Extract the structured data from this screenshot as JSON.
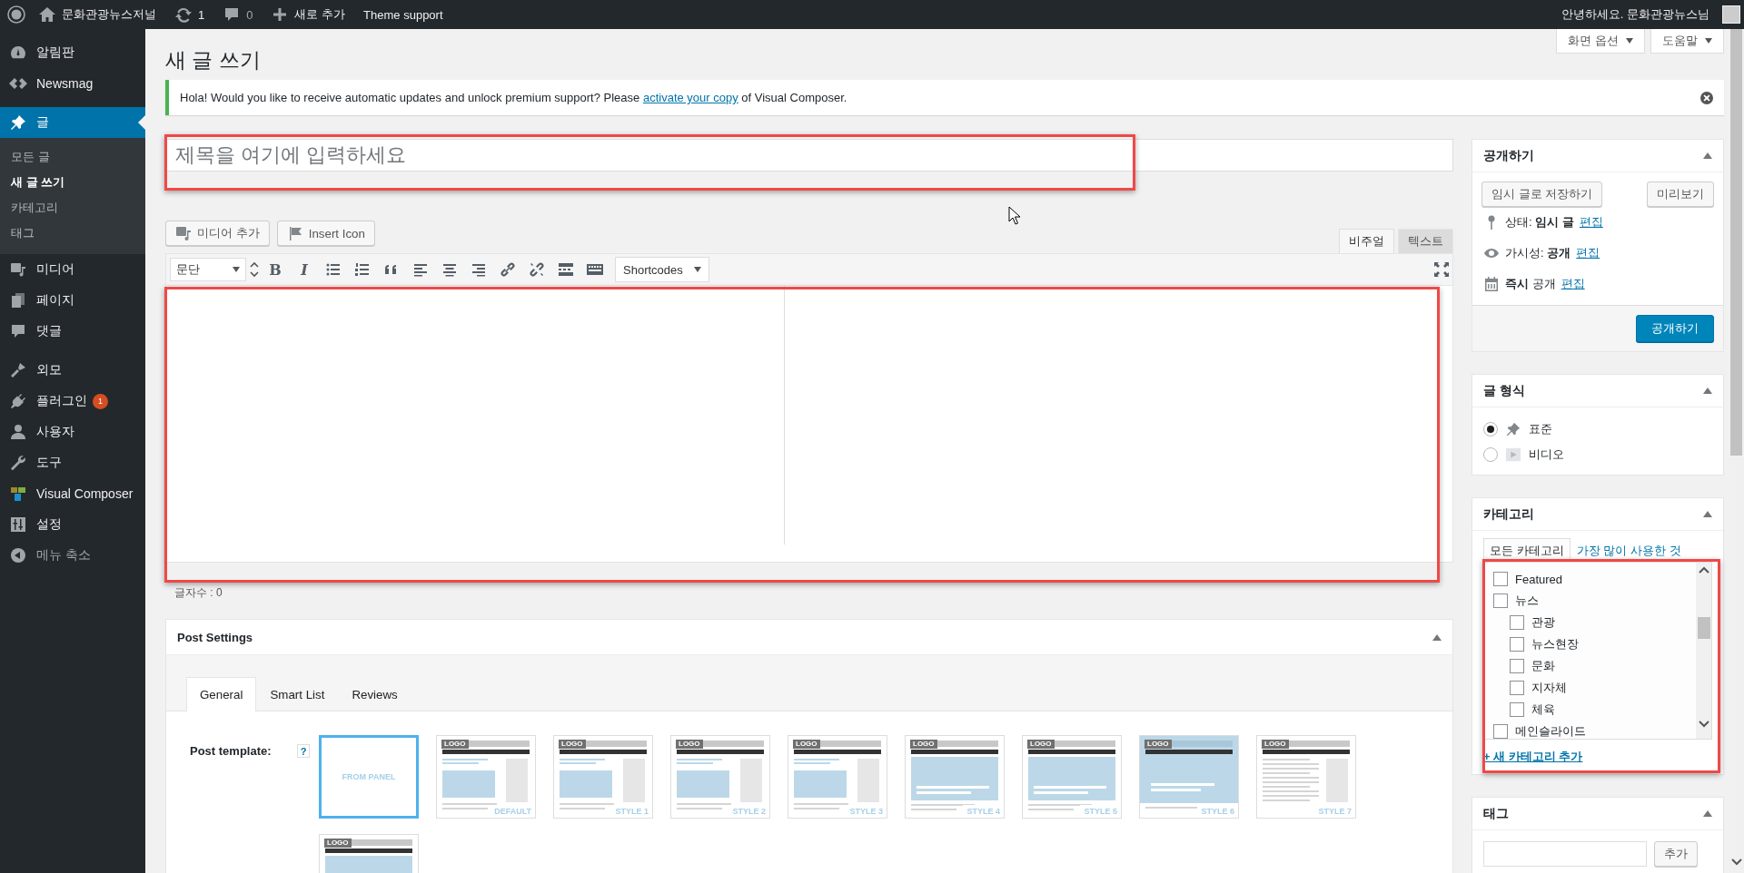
{
  "admin_bar": {
    "site_name": "문화관광뉴스저널",
    "updates": "1",
    "comments": "0",
    "new_label": "새로 추가",
    "theme_support": "Theme support",
    "greeting": "안녕하세요. 문화관광뉴스님"
  },
  "menu": [
    {
      "label": "알림판",
      "selected": false
    },
    {
      "label": "Newsmag",
      "selected": false
    },
    {
      "label": "글",
      "selected": true,
      "gap_before": true,
      "children": [
        {
          "label": "모든 글",
          "selected": false
        },
        {
          "label": "새 글 쓰기",
          "selected": true
        },
        {
          "label": "카테고리",
          "selected": false
        },
        {
          "label": "태그",
          "selected": false
        }
      ]
    },
    {
      "label": "미디어",
      "selected": false
    },
    {
      "label": "페이지",
      "selected": false
    },
    {
      "label": "댓글",
      "selected": false
    },
    {
      "label": "외모",
      "selected": false,
      "gap_before": true
    },
    {
      "label": "플러그인",
      "selected": false,
      "badge": "1"
    },
    {
      "label": "사용자",
      "selected": false
    },
    {
      "label": "도구",
      "selected": false
    },
    {
      "label": "Visual Composer",
      "selected": false
    },
    {
      "label": "설정",
      "selected": false
    },
    {
      "label": "메뉴 축소",
      "selected": false,
      "kind": "collapse"
    }
  ],
  "screen_links": [
    "화면 옵션",
    "도움말"
  ],
  "page_title": "새 글 쓰기",
  "notice": {
    "text": "Hola! Would you like to receive automatic updates and unlock premium support? Please ",
    "link": "activate your copy",
    "text_after": " of Visual Composer."
  },
  "title_field": {
    "placeholder": "제목을 여기에 입력하세요"
  },
  "editor": {
    "media_buttons": [
      "미디어 추가",
      "Insert Icon"
    ],
    "modes": [
      {
        "label": "비주얼",
        "selected": true
      },
      {
        "label": "텍스트",
        "selected": false
      }
    ],
    "format": "문단",
    "bold": "B",
    "italic": "I",
    "shortcodes": "Shortcodes",
    "word_count": "글자수 : 0"
  },
  "post_settings": {
    "title": "Post Settings",
    "tabs": [
      {
        "label": "General",
        "selected": true
      },
      {
        "label": "Smart List",
        "selected": false
      },
      {
        "label": "Reviews",
        "selected": false
      }
    ],
    "template_label": "Post template:",
    "help": "?",
    "templates": [
      {
        "label": "FROM PANEL",
        "kind": "panel",
        "selected": true
      },
      {
        "logo": "LOGO",
        "label": "DEFAULT",
        "kind": "sidebar",
        "selected": false
      },
      {
        "logo": "LOGO",
        "label": "STYLE 1",
        "kind": "sidebar",
        "selected": false
      },
      {
        "logo": "LOGO",
        "label": "STYLE 2",
        "kind": "sidebar",
        "selected": false
      },
      {
        "logo": "LOGO",
        "label": "STYLE 3",
        "kind": "sidebar",
        "selected": false
      },
      {
        "logo": "LOGO",
        "label": "STYLE 4",
        "kind": "full",
        "selected": false
      },
      {
        "logo": "LOGO",
        "label": "STYLE 5",
        "kind": "full",
        "selected": false
      },
      {
        "logo": "LOGO",
        "label": "STYLE 6",
        "kind": "overlay",
        "selected": false
      },
      {
        "logo": "LOGO",
        "label": "STYLE 7",
        "kind": "text",
        "selected": false
      },
      {
        "logo": "LOGO",
        "kind": "full",
        "selected": false
      }
    ]
  },
  "publish": {
    "title": "공개하기",
    "save_draft": "임시 글로 저장하기",
    "preview": "미리보기",
    "rows": [
      {
        "text": "상태: **임시 글**",
        "link": "편집"
      },
      {
        "text": "가시성: **공개**",
        "link": "편집"
      },
      {
        "text": "**즉시** 공개",
        "link": "편집"
      }
    ],
    "publish_button": "공개하기"
  },
  "format": {
    "title": "글 형식",
    "options": [
      {
        "label": "표준",
        "selected": true
      },
      {
        "label": "비디오",
        "selected": false
      }
    ]
  },
  "categories": {
    "title": "카테고리",
    "tabs": [
      {
        "label": "모든 카테고리",
        "selected": true
      },
      {
        "label": "가장 많이 사용한 것",
        "selected": false
      }
    ],
    "items": [
      {
        "label": "Featured",
        "checked": false
      },
      {
        "label": "뉴스",
        "checked": false,
        "children": [
          {
            "label": "관광",
            "checked": false
          },
          {
            "label": "뉴스현장",
            "checked": false
          },
          {
            "label": "문화",
            "checked": false
          },
          {
            "label": "지자체",
            "checked": false
          },
          {
            "label": "체육",
            "checked": false
          }
        ]
      },
      {
        "label": "메인슬라이드",
        "checked": false
      }
    ],
    "add_link": "+ 새 카테고리 추가"
  },
  "tags": {
    "title": "태그",
    "button": "추가"
  }
}
